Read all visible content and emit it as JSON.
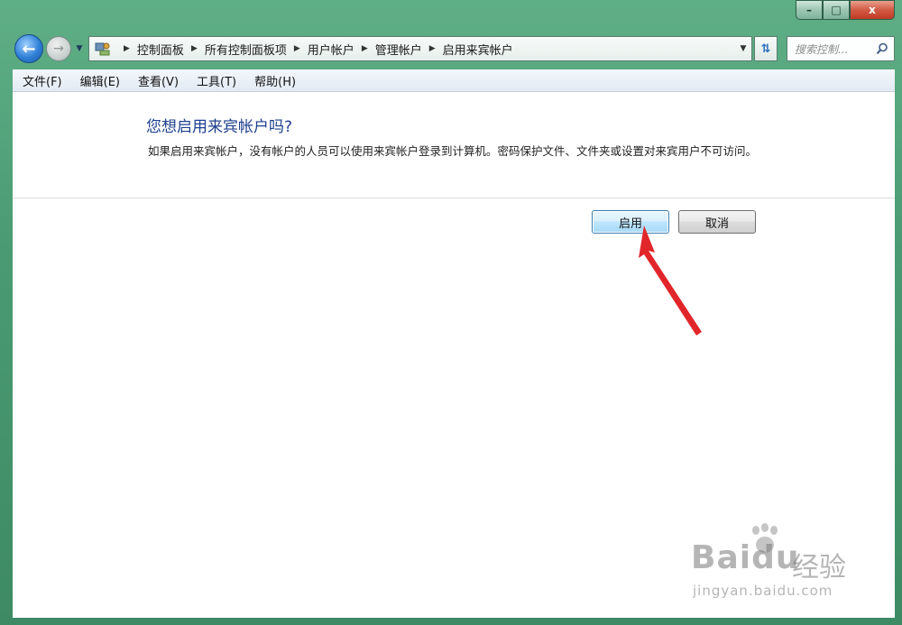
{
  "window": {
    "caption": {
      "minimize": "–",
      "maximize": "□",
      "close": "x"
    }
  },
  "nav": {
    "back_icon": "back-arrow-icon",
    "forward_icon": "forward-arrow-icon",
    "breadcrumbs": [
      "控制面板",
      "所有控制面板项",
      "用户帐户",
      "管理帐户",
      "启用来宾帐户"
    ],
    "search_placeholder": "搜索控制..."
  },
  "menu": {
    "items": [
      "文件(F)",
      "编辑(E)",
      "查看(V)",
      "工具(T)",
      "帮助(H)"
    ]
  },
  "dialog": {
    "heading": "您想启用来宾帐户吗?",
    "description": "如果启用来宾帐户，没有帐户的人员可以使用来宾帐户登录到计算机。密码保护文件、文件夹或设置对来宾用户不可访问。",
    "enable_label": "启用",
    "cancel_label": "取消"
  },
  "watermark": {
    "brand": "Baidu",
    "cn": "经验",
    "url": "jingyan.baidu.com"
  },
  "colors": {
    "frame": "#4a9b74",
    "heading": "#1e3f8f",
    "annotation_arrow": "#e0262a"
  }
}
